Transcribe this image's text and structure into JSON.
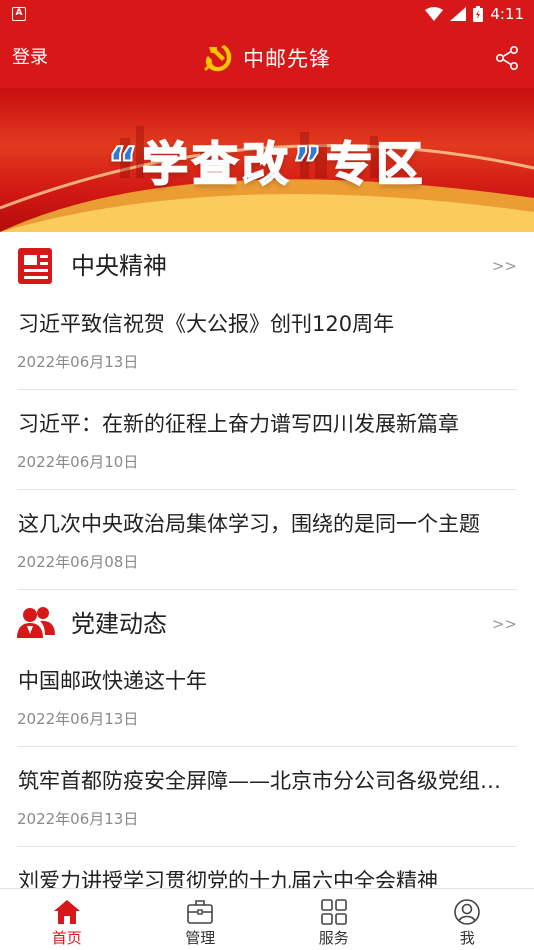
{
  "colors": {
    "brand": "#d81818",
    "text": "#222222",
    "muted": "#8a8a8a",
    "more": "#999999"
  },
  "status_bar": {
    "notification_icon": "A",
    "time": "4:11"
  },
  "header": {
    "login_label": "登录",
    "title": "中邮先锋",
    "emblem_icon": "party-emblem-icon",
    "share_icon": "share-icon"
  },
  "banner": {
    "title": "“学查改”专区"
  },
  "sections": [
    {
      "title": "中央精神",
      "more": ">>",
      "icon": "document-icon",
      "items": [
        {
          "title": "习近平致信祝贺《大公报》创刊120周年",
          "date": "2022年06月13日"
        },
        {
          "title": "习近平：在新的征程上奋力谱写四川发展新篇章",
          "date": "2022年06月10日"
        },
        {
          "title": "这几次中央政治局集体学习，围绕的是同一个主题",
          "date": "2022年06月08日"
        }
      ]
    },
    {
      "title": "党建动态",
      "more": ">>",
      "icon": "people-icon",
      "items": [
        {
          "title": "中国邮政快递这十年",
          "date": "2022年06月13日"
        },
        {
          "title": "筑牢首都防疫安全屏障——北京市分公司各级党组织在行动",
          "date": "2022年06月13日"
        },
        {
          "title": "刘爱力讲授学习贯彻党的十九届六中全会精神",
          "date": ""
        }
      ]
    }
  ],
  "tabs": [
    {
      "label": "首页",
      "icon": "home-icon",
      "active": true
    },
    {
      "label": "管理",
      "icon": "briefcase-icon",
      "active": false
    },
    {
      "label": "服务",
      "icon": "grid-icon",
      "active": false
    },
    {
      "label": "我",
      "icon": "user-icon",
      "active": false
    }
  ]
}
